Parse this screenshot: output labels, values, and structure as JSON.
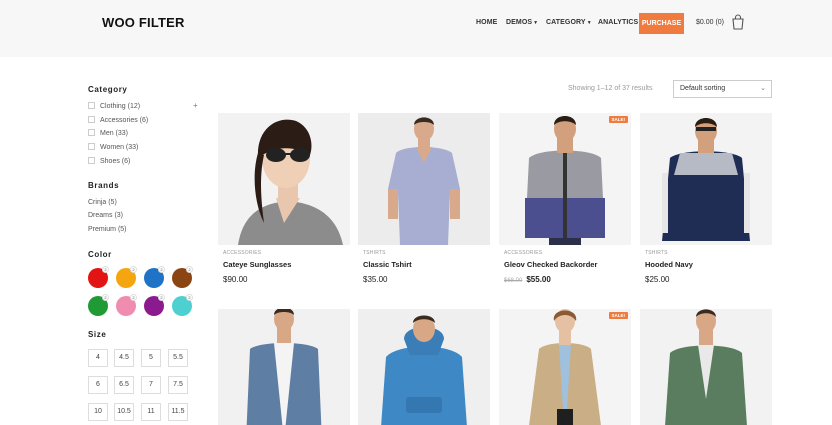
{
  "header": {
    "logo": "WOO FILTER",
    "nav": [
      {
        "label": "HOME",
        "has_caret": false
      },
      {
        "label": "DEMOS",
        "has_caret": true
      },
      {
        "label": "CATEGORY",
        "has_caret": true
      },
      {
        "label": "ANALYTICS",
        "has_caret": false
      }
    ],
    "purchase_label": "PURCHASE",
    "cart_total": "$0.00 (0)",
    "cart_icon": "shopping-bag-icon",
    "accent_color": "#f07b3f"
  },
  "sidebar": {
    "category_title": "Category",
    "categories": [
      {
        "label": "Clothing (12)"
      },
      {
        "label": "Accessories (6)"
      },
      {
        "label": "Men (33)"
      },
      {
        "label": "Women (33)"
      },
      {
        "label": "Shoes (6)"
      }
    ],
    "expand_symbol": "+",
    "brands_title": "Brands",
    "brands": [
      {
        "label": "Crinja (5)"
      },
      {
        "label": "Dreams (3)"
      },
      {
        "label": "Premium (5)"
      }
    ],
    "color_title": "Color",
    "colors": [
      {
        "hex": "#e31414",
        "count": "2"
      },
      {
        "hex": "#f5a50f",
        "count": "2"
      },
      {
        "hex": "#1f73c6",
        "count": "2"
      },
      {
        "hex": "#8b4513",
        "count": "2"
      },
      {
        "hex": "#1f9a35",
        "count": "2"
      },
      {
        "hex": "#f08cb0",
        "count": "2"
      },
      {
        "hex": "#8b1a8f",
        "count": "2"
      },
      {
        "hex": "#4dd0cf",
        "count": "2"
      }
    ],
    "size_title": "Size",
    "sizes": [
      "4",
      "4.5",
      "5",
      "5.5",
      "6",
      "6.5",
      "7",
      "7.5",
      "10",
      "10.5",
      "11",
      "11.5"
    ]
  },
  "toolbar": {
    "showing": "Showing 1–12 of 37 results",
    "sort": "Default sorting",
    "sort_icon": "chevron-down-icon"
  },
  "products": [
    {
      "category": "ACCESSORIES",
      "name": "Cateye Sunglasses",
      "price": "$90.00",
      "sale": false
    },
    {
      "category": "TSHIRTS",
      "name": "Classic Tshirt",
      "price": "$35.00",
      "sale": false
    },
    {
      "category": "ACCESSORIES",
      "name": "Gleov Checked Backorder",
      "old_price": "$68.00",
      "price": "$55.00",
      "sale": true,
      "sale_label": "SALE!"
    },
    {
      "category": "TSHIRTS",
      "name": "Hooded Navy",
      "price": "$25.00",
      "sale": false
    },
    {
      "sale": false
    },
    {
      "sale": false
    },
    {
      "sale": true,
      "sale_label": "SALE!"
    },
    {
      "sale": false
    }
  ]
}
